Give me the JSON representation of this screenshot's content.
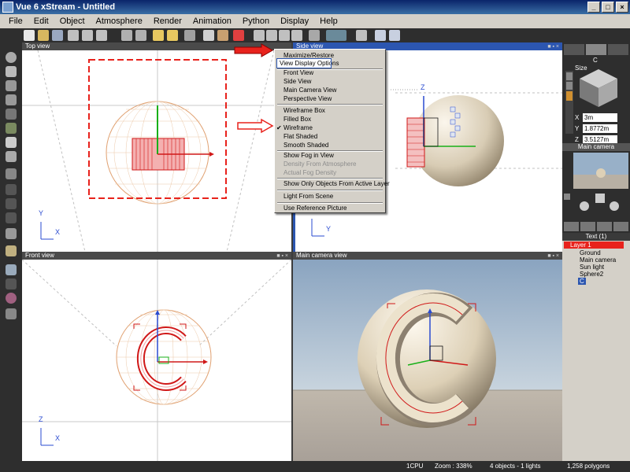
{
  "window": {
    "title": "Vue 6 xStream - Untitled",
    "controls": [
      "_",
      "□",
      "×"
    ]
  },
  "menubar": [
    "File",
    "Edit",
    "Object",
    "Atmosphere",
    "Render",
    "Animation",
    "Python",
    "Display",
    "Help"
  ],
  "viewports": {
    "top": {
      "label": "Top view",
      "axis_v": "Y",
      "axis_h": "X"
    },
    "side": {
      "label": "Side view",
      "axis_v": "Z",
      "axis_h": "Y",
      "buttons": "■ ▪ ×"
    },
    "front": {
      "label": "Front view",
      "axis_v": "Z",
      "axis_h": "X",
      "buttons": "■ ▪ ×"
    },
    "camera": {
      "label": "Main camera view",
      "buttons": "■ ▪ ×"
    }
  },
  "context_menu": {
    "items": [
      {
        "label": "Maximize/Restore",
        "enabled": true
      },
      {
        "label": "View Display Options",
        "enabled": true,
        "highlighted": true
      },
      {
        "label": "Front View",
        "enabled": true
      },
      {
        "label": "Side View",
        "enabled": true
      },
      {
        "label": "Main Camera View",
        "enabled": true
      },
      {
        "label": "Perspective View",
        "enabled": true
      },
      {
        "label": "Wireframe Box",
        "enabled": true
      },
      {
        "label": "Filled Box",
        "enabled": true
      },
      {
        "label": "Wireframe",
        "enabled": true,
        "checked": true
      },
      {
        "label": "Flat Shaded",
        "enabled": true
      },
      {
        "label": "Smooth Shaded",
        "enabled": true
      },
      {
        "label": "Show Fog in View",
        "enabled": true
      },
      {
        "label": "Density From Atmosphere",
        "enabled": false
      },
      {
        "label": "Actual Fog Density",
        "enabled": false
      },
      {
        "label": "Show Only Objects From Active Layer",
        "enabled": true
      },
      {
        "label": "Light From Scene",
        "enabled": true
      },
      {
        "label": "Use Reference Picture",
        "enabled": true
      }
    ],
    "check_glyph": "✔"
  },
  "right_panel": {
    "object_label": "C",
    "size_label": "Size",
    "fields": [
      {
        "axis": "X",
        "value": "3m"
      },
      {
        "axis": "Y",
        "value": "1.8772m"
      },
      {
        "axis": "Z",
        "value": "3.5127m"
      }
    ],
    "camera_label": "Main camera",
    "layer_header": "Text (1)",
    "tree": [
      "Layer 1",
      "Ground",
      "Main camera",
      "Sun light",
      "Sphere2",
      "C"
    ]
  },
  "status": {
    "cpu": "1CPU",
    "zoom": "Zoom : 338%",
    "objects": "4 objects - 1 lights",
    "polygons": "1,258 polygons"
  },
  "colors": {
    "accent": "#2c56b0",
    "annotation_red": "#e8221c",
    "wire_orange": "#e0a070",
    "sphere": "#d8ccb4"
  }
}
